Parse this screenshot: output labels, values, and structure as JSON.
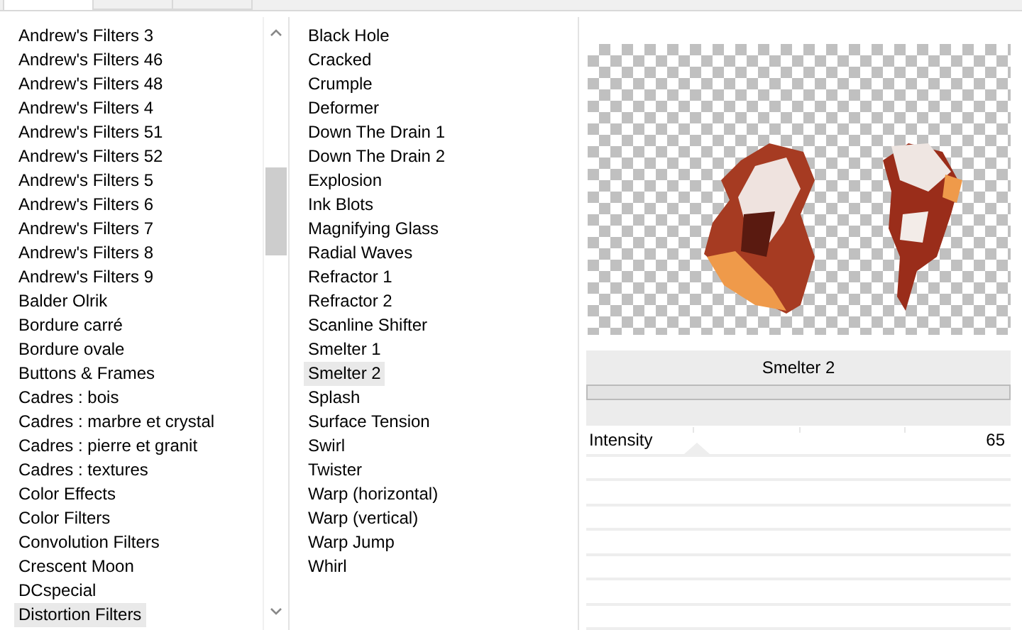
{
  "tabs": [
    {
      "selected": true
    },
    {
      "selected": false
    },
    {
      "selected": false
    }
  ],
  "categories": {
    "items": [
      {
        "label": "Andrew's Filters 3",
        "selected": false
      },
      {
        "label": "Andrew's Filters 46",
        "selected": false
      },
      {
        "label": "Andrew's Filters 48",
        "selected": false
      },
      {
        "label": "Andrew's Filters 4",
        "selected": false
      },
      {
        "label": "Andrew's Filters 51",
        "selected": false
      },
      {
        "label": "Andrew's Filters 52",
        "selected": false
      },
      {
        "label": "Andrew's Filters 5",
        "selected": false
      },
      {
        "label": "Andrew's Filters 6",
        "selected": false
      },
      {
        "label": "Andrew's Filters 7",
        "selected": false
      },
      {
        "label": "Andrew's Filters 8",
        "selected": false
      },
      {
        "label": "Andrew's Filters 9",
        "selected": false
      },
      {
        "label": "Balder Olrik",
        "selected": false
      },
      {
        "label": "Bordure carré",
        "selected": false
      },
      {
        "label": "Bordure ovale",
        "selected": false
      },
      {
        "label": "Buttons & Frames",
        "selected": false
      },
      {
        "label": "Cadres : bois",
        "selected": false
      },
      {
        "label": "Cadres : marbre et crystal",
        "selected": false
      },
      {
        "label": "Cadres : pierre et granit",
        "selected": false
      },
      {
        "label": "Cadres : textures",
        "selected": false
      },
      {
        "label": "Color Effects",
        "selected": false
      },
      {
        "label": "Color Filters",
        "selected": false
      },
      {
        "label": "Convolution Filters",
        "selected": false
      },
      {
        "label": "Crescent Moon",
        "selected": false
      },
      {
        "label": "DCspecial",
        "selected": false
      },
      {
        "label": "Distortion Filters",
        "selected": true
      }
    ]
  },
  "filters": {
    "items": [
      {
        "label": "Black Hole",
        "selected": false
      },
      {
        "label": "Cracked",
        "selected": false
      },
      {
        "label": "Crumple",
        "selected": false
      },
      {
        "label": "Deformer",
        "selected": false
      },
      {
        "label": "Down The Drain 1",
        "selected": false
      },
      {
        "label": "Down The Drain 2",
        "selected": false
      },
      {
        "label": "Explosion",
        "selected": false
      },
      {
        "label": "Ink Blots",
        "selected": false
      },
      {
        "label": "Magnifying Glass",
        "selected": false
      },
      {
        "label": "Radial Waves",
        "selected": false
      },
      {
        "label": "Refractor 1",
        "selected": false
      },
      {
        "label": "Refractor 2",
        "selected": false
      },
      {
        "label": "Scanline Shifter",
        "selected": false
      },
      {
        "label": "Smelter 1",
        "selected": false
      },
      {
        "label": "Smelter 2",
        "selected": true
      },
      {
        "label": "Splash",
        "selected": false
      },
      {
        "label": "Surface Tension",
        "selected": false
      },
      {
        "label": "Swirl",
        "selected": false
      },
      {
        "label": "Twister",
        "selected": false
      },
      {
        "label": "Warp (horizontal)",
        "selected": false
      },
      {
        "label": "Warp (vertical)",
        "selected": false
      },
      {
        "label": "Warp Jump",
        "selected": false
      },
      {
        "label": "Whirl",
        "selected": false
      }
    ]
  },
  "settings": {
    "filter_title": "Smelter 2",
    "sliders": [
      {
        "label": "Intensity",
        "value": "65",
        "level": 0.26
      }
    ]
  }
}
